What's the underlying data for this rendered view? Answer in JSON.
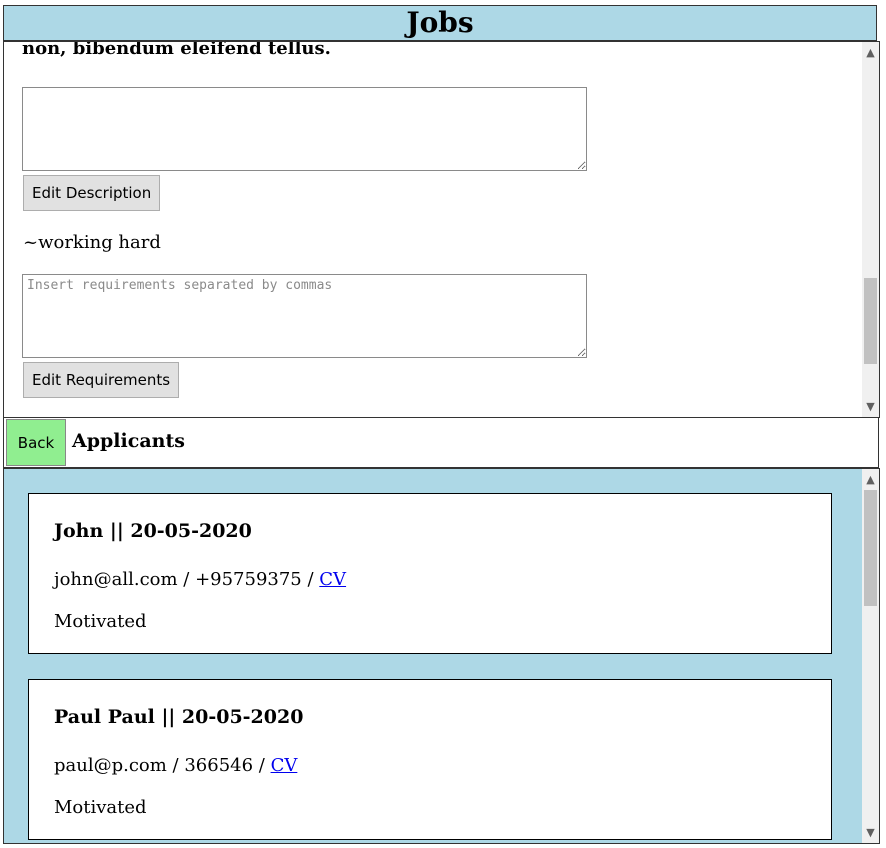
{
  "header": {
    "title": "Jobs"
  },
  "job": {
    "description_text": "non, bibendum eleifend tellus.",
    "description_input": {
      "value": "",
      "placeholder": ""
    },
    "edit_description_label": "Edit Description",
    "requirements_text": "~working hard",
    "requirements_input": {
      "value": "",
      "placeholder": "Insert requirements separated by commas"
    },
    "edit_requirements_label": "Edit Requirements"
  },
  "nav": {
    "back_label": "Back",
    "section_title": "Applicants"
  },
  "applicants": [
    {
      "heading": "John || 20-05-2020",
      "contact": "john@all.com / +95759375 / ",
      "cv_label": "CV",
      "note": "Motivated"
    },
    {
      "heading": "Paul Paul || 20-05-2020",
      "contact": "paul@p.com / 366546 / ",
      "cv_label": "CV",
      "note": "Motivated"
    }
  ],
  "colors": {
    "header_bg": "#add8e6",
    "applicants_bg": "#add8e6",
    "back_button": "#90ee90",
    "link": "#0000ee"
  },
  "icons": {
    "scroll_up": "chevron-up-icon",
    "scroll_down": "chevron-down-icon"
  },
  "scroll": {
    "job_panel_position": 0.85,
    "applicants_panel_position": 0.0
  }
}
